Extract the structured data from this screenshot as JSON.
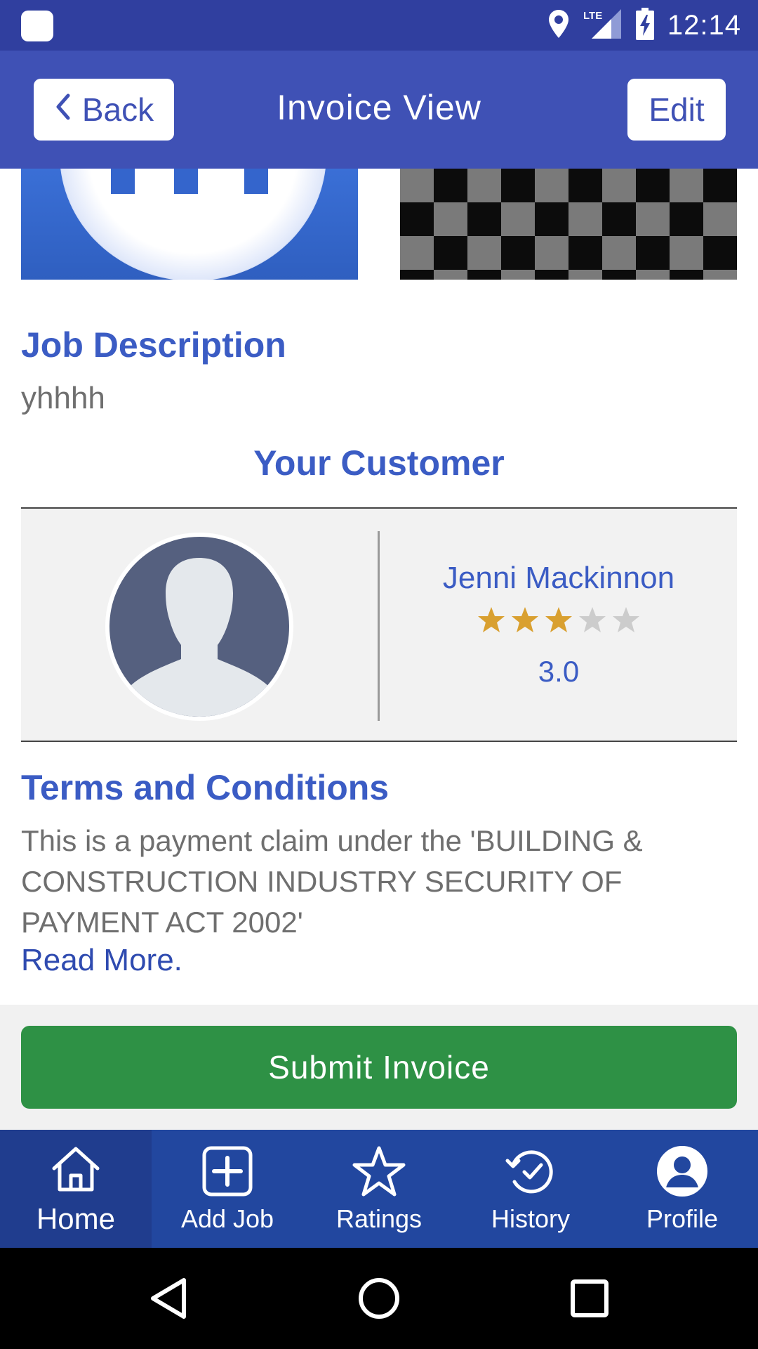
{
  "status_bar": {
    "time": "12:14",
    "network": "LTE",
    "icons": [
      "app-notification-icon",
      "location-pin-icon",
      "lte-signal-icon",
      "battery-charging-icon"
    ]
  },
  "header": {
    "back_label": "Back",
    "title": "Invoice View",
    "edit_label": "Edit"
  },
  "job_description": {
    "heading": "Job Description",
    "text": "yhhhh"
  },
  "customer": {
    "heading": "Your Customer",
    "name": "Jenni Mackinnon",
    "rating": "3.0",
    "rating_value": 3,
    "rating_max": 5
  },
  "terms": {
    "heading": "Terms and Conditions",
    "text": "This is a payment claim under the 'BUILDING & CONSTRUCTION INDUSTRY SECURITY OF PAYMENT ACT 2002'",
    "read_more": "Read More."
  },
  "actions": {
    "submit_label": "Submit Invoice"
  },
  "bottom_nav": {
    "items": [
      {
        "label": "Home",
        "icon": "home-icon",
        "active": true
      },
      {
        "label": "Add Job",
        "icon": "add-job-icon",
        "active": false
      },
      {
        "label": "Ratings",
        "icon": "star-icon",
        "active": false
      },
      {
        "label": "History",
        "icon": "history-icon",
        "active": false
      },
      {
        "label": "Profile",
        "icon": "profile-icon",
        "active": false
      }
    ]
  },
  "colors": {
    "status_bar": "#303f9f",
    "header": "#3f51b5",
    "accent_text": "#3b5cc4",
    "submit_button": "#2e9145",
    "bottom_nav": "#22479f",
    "star_filled": "#d9a030",
    "star_empty": "#cccccc"
  }
}
